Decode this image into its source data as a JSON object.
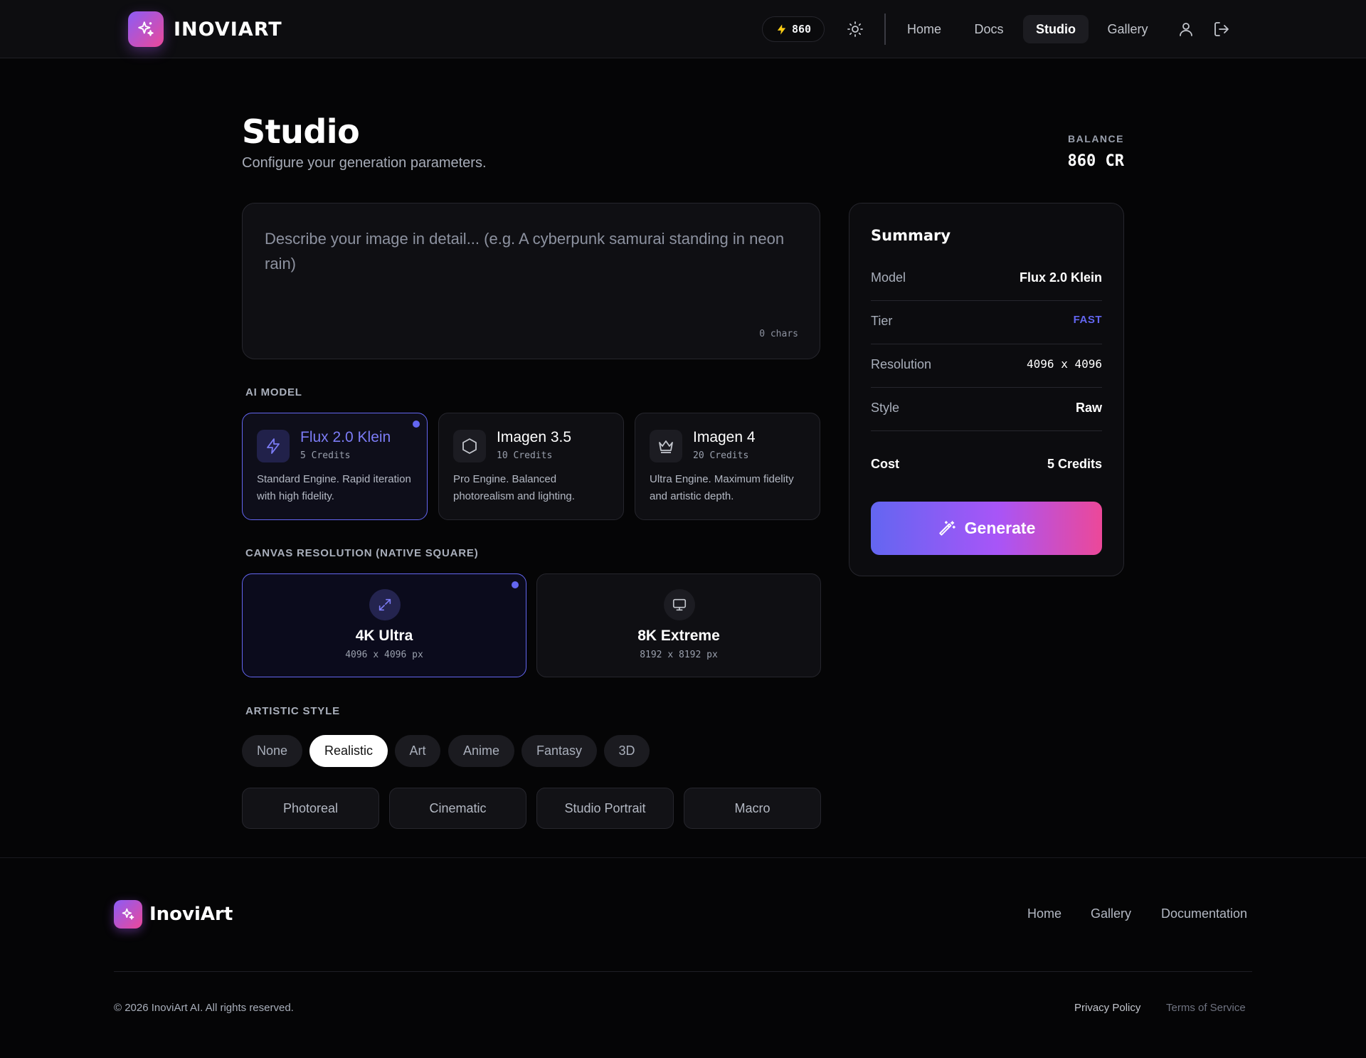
{
  "nav": {
    "brand": "INOVIART",
    "credits": "860",
    "links": [
      {
        "label": "Home"
      },
      {
        "label": "Docs"
      },
      {
        "label": "Studio",
        "active": true
      },
      {
        "label": "Gallery"
      }
    ]
  },
  "header": {
    "title": "Studio",
    "subtitle": "Configure your generation parameters.",
    "balance_label": "BALANCE",
    "balance_value": "860 CR"
  },
  "prompt": {
    "placeholder": "Describe your image in detail... (e.g. A cyberpunk samurai standing in neon rain)",
    "char_count": "0 chars"
  },
  "ai_model": {
    "label": "AI MODEL",
    "models": [
      {
        "name": "Flux 2.0 Klein",
        "credits": "5 Credits",
        "desc": "Standard Engine. Rapid iteration with high fidelity.",
        "icon": "bolt-icon",
        "selected": true
      },
      {
        "name": "Imagen 3.5",
        "credits": "10 Credits",
        "desc": "Pro Engine. Balanced photorealism and lighting.",
        "icon": "hexagon-icon"
      },
      {
        "name": "Imagen 4",
        "credits": "20 Credits",
        "desc": "Ultra Engine. Maximum fidelity and artistic depth.",
        "icon": "crown-icon"
      }
    ]
  },
  "resolution": {
    "label": "CANVAS RESOLUTION (NATIVE SQUARE)",
    "options": [
      {
        "name": "4K Ultra",
        "px": "4096 x 4096 px",
        "icon": "expand-icon",
        "selected": true
      },
      {
        "name": "8K Extreme",
        "px": "8192 x 8192 px",
        "icon": "monitor-icon"
      }
    ]
  },
  "style": {
    "label": "ARTISTIC STYLE",
    "tabs": [
      "None",
      "Realistic",
      "Art",
      "Anime",
      "Fantasy",
      "3D"
    ],
    "active_tab": "Realistic",
    "presets": [
      "Photoreal",
      "Cinematic",
      "Studio Portrait",
      "Macro"
    ]
  },
  "summary": {
    "title": "Summary",
    "rows": [
      {
        "key": "Model",
        "value": "Flux 2.0 Klein"
      },
      {
        "key": "Tier",
        "value": "FAST"
      },
      {
        "key": "Resolution",
        "value": "4096 x 4096"
      },
      {
        "key": "Style",
        "value": "Raw"
      }
    ],
    "cost_label": "Cost",
    "cost_value": "5 Credits",
    "generate_label": "Generate"
  },
  "footer": {
    "brand": "InoviArt",
    "links": [
      "Home",
      "Gallery",
      "Documentation"
    ],
    "copyright": "© 2026 InoviArt AI. All rights reserved.",
    "legal": [
      "Privacy Policy",
      "Terms of Service"
    ]
  },
  "colors": {
    "accent": "#6366f1",
    "gradient_start": "#8b5cf6",
    "gradient_end": "#ec4899",
    "background": "#050506"
  }
}
